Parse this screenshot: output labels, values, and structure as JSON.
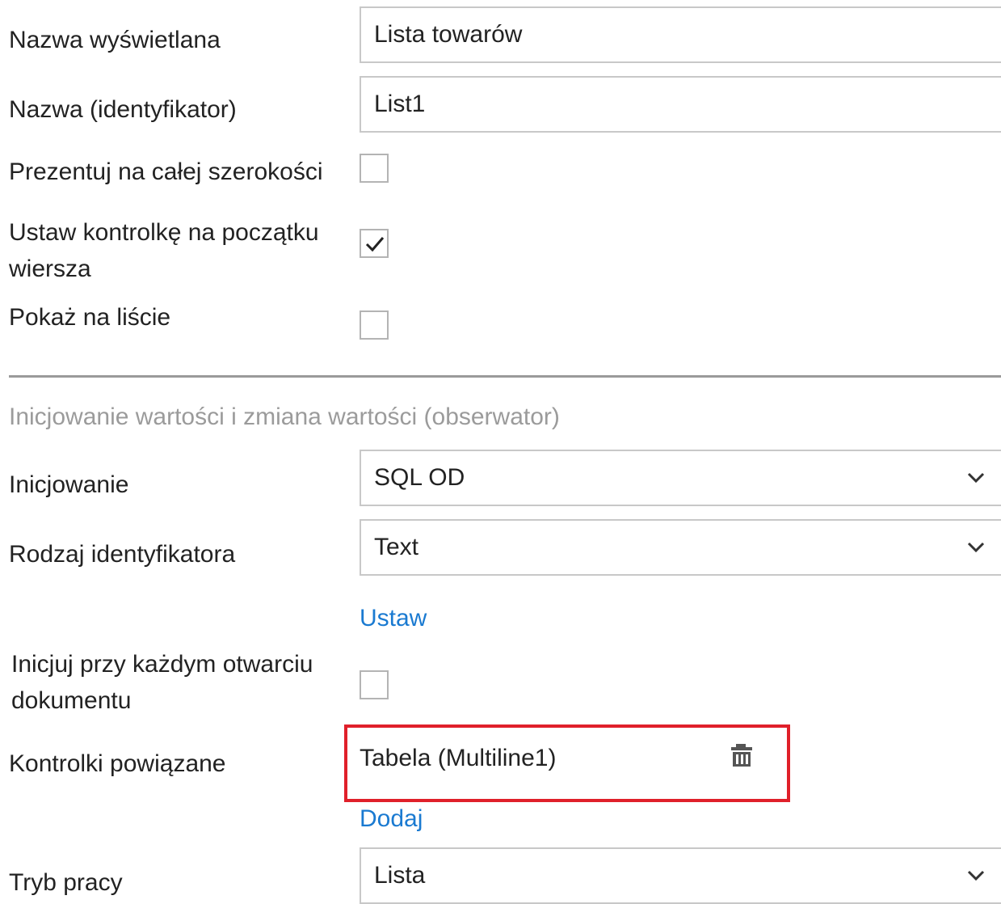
{
  "fields": {
    "display_name": {
      "label": "Nazwa wyświetlana",
      "value": "Lista towarów"
    },
    "identifier": {
      "label": "Nazwa (identyfikator)",
      "value": "List1"
    },
    "full_width": {
      "label": "Prezentuj na całej szerokości",
      "checked": false
    },
    "row_start": {
      "label_line1": "Ustaw kontrolkę na początku",
      "label_line2": "wiersza",
      "checked": true
    },
    "show_in_list": {
      "label": "Pokaż na liście",
      "checked": false
    }
  },
  "section": {
    "title": "Inicjowanie wartości i zmiana wartości (obserwator)"
  },
  "init": {
    "label": "Inicjowanie",
    "selected": "SQL OD"
  },
  "id_type": {
    "label": "Rodzaj identyfikatora",
    "selected": "Text"
  },
  "set_link": "Ustaw",
  "init_on_open": {
    "label_line1": "Inicjuj przy każdym otwarciu",
    "label_line2": "dokumentu",
    "checked": false
  },
  "related": {
    "label": "Kontrolki powiązane",
    "item": "Tabela (Multiline1)",
    "add_link": "Dodaj"
  },
  "work_mode": {
    "label": "Tryb pracy",
    "selected": "Lista"
  },
  "colors": {
    "link": "#1a7ad1",
    "highlight": "#e0202a",
    "section_title": "#9b9b9b"
  }
}
